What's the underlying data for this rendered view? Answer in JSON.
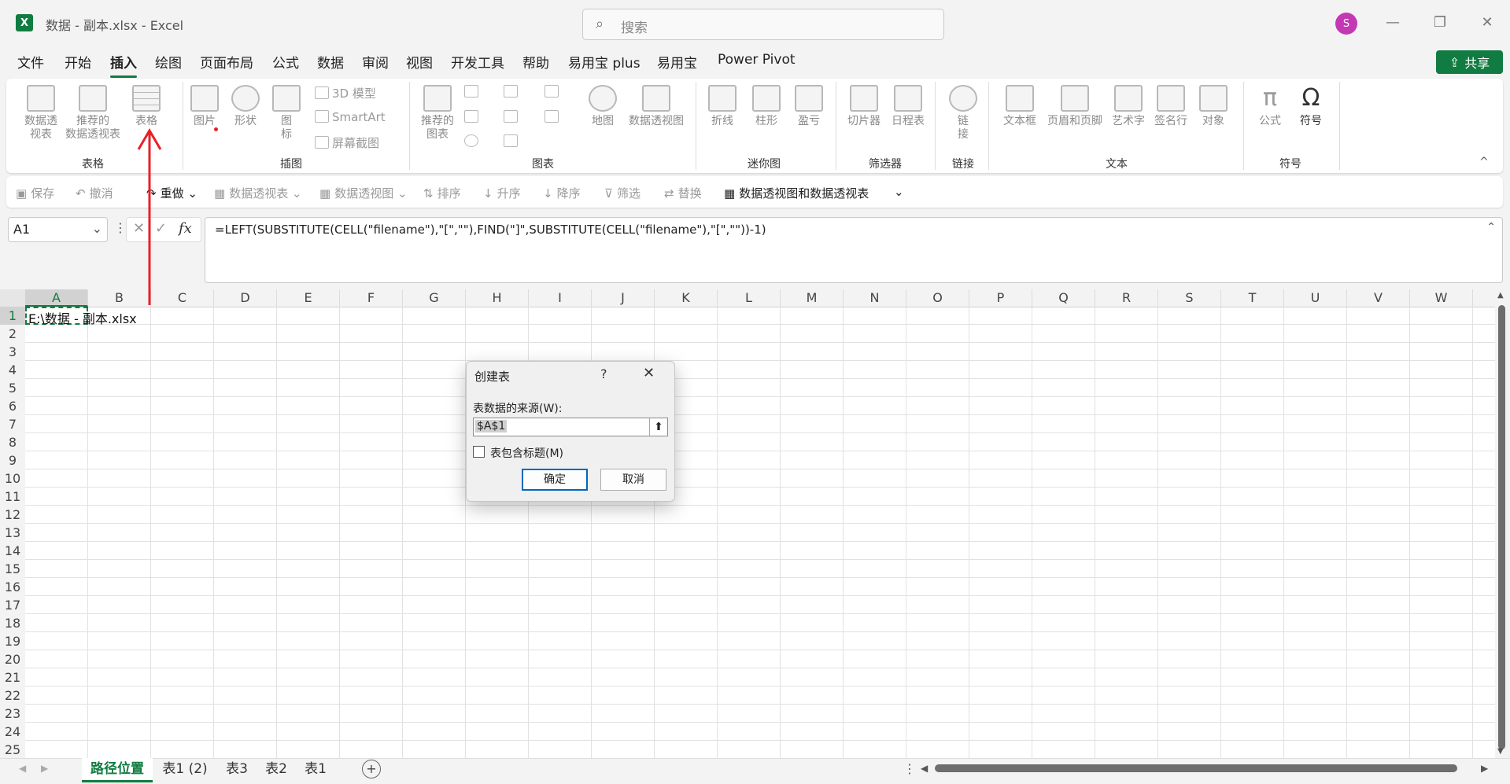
{
  "window": {
    "logo": "X",
    "title": "数据 - 副本.xlsx  -  Excel",
    "search_placeholder": "搜索",
    "avatar_initial": "S",
    "minimize": "—",
    "restore": "❐",
    "close": "✕"
  },
  "menu": {
    "tabs": [
      "文件",
      "开始",
      "插入",
      "绘图",
      "页面布局",
      "公式",
      "数据",
      "审阅",
      "视图",
      "开发工具",
      "帮助",
      "易用宝 plus",
      "易用宝",
      "Power Pivot"
    ],
    "active_index": 2,
    "share_label": "共享"
  },
  "ribbon": {
    "pivot_table": "数据透\n视表",
    "recommended_pivot": "推荐的\n数据透视表",
    "table": "表格",
    "picture": "图片",
    "shapes": "形状",
    "icons": "图\n标",
    "model3d": "3D 模型",
    "smartart": "SmartArt",
    "screenshot": "屏幕截图",
    "recommended_charts": "推荐的\n图表",
    "map": "地图",
    "pivot_chart": "数据透视图",
    "line": "折线",
    "column": "柱形",
    "winloss": "盈亏",
    "slicer": "切片器",
    "timeline": "日程表",
    "link": "链\n接",
    "textbox": "文本框",
    "header_footer": "页眉和页脚",
    "wordart": "艺术字",
    "signature": "签名行",
    "object": "对象",
    "equation": "公式",
    "symbol": "符号",
    "groups": {
      "tables": "表格",
      "illustrations": "插图",
      "charts": "图表",
      "sparklines": "迷你图",
      "filters": "筛选器",
      "links": "链接",
      "text": "文本",
      "symbols": "符号"
    },
    "collapse": "^"
  },
  "quick_access": {
    "save": "保存",
    "undo": "撤消",
    "redo": "重做",
    "pivot_table": "数据透视表",
    "pivot_chart": "数据透视图",
    "sort": "排序",
    "sort_asc": "升序",
    "sort_desc": "降序",
    "filter": "筛选",
    "replace": "替换",
    "pivot_both": "数据透视图和数据透视表"
  },
  "formula_bar": {
    "name_box": "A1",
    "fx": "fx",
    "formula": "=LEFT(SUBSTITUTE(CELL(\"filename\"),\"[\",\"\"),FIND(\"]\",SUBSTITUTE(CELL(\"filename\"),\"[\",\"\"))-1)"
  },
  "grid": {
    "columns": [
      "A",
      "B",
      "C",
      "D",
      "E",
      "F",
      "G",
      "H",
      "I",
      "J",
      "K",
      "L",
      "M",
      "N",
      "O",
      "P",
      "Q",
      "R",
      "S",
      "T",
      "U",
      "V",
      "W"
    ],
    "row_count": 25,
    "cell_a1": "E:\\数据 - 副本.xlsx"
  },
  "sheets": {
    "tabs": [
      "路径位置",
      "表1 (2)",
      "表3",
      "表2",
      "表1"
    ],
    "active_index": 0,
    "add": "+"
  },
  "dialog": {
    "title": "创建表",
    "help": "?",
    "close": "✕",
    "source_label": "表数据的来源(W):",
    "source_value": "$A$1",
    "header_checkbox_label": "表包含标题(M)",
    "header_checked": false,
    "ok": "确定",
    "cancel": "取消"
  },
  "colors": {
    "accent": "#107c41",
    "annotation": "#e8202a",
    "avatar": "#c239b3"
  }
}
